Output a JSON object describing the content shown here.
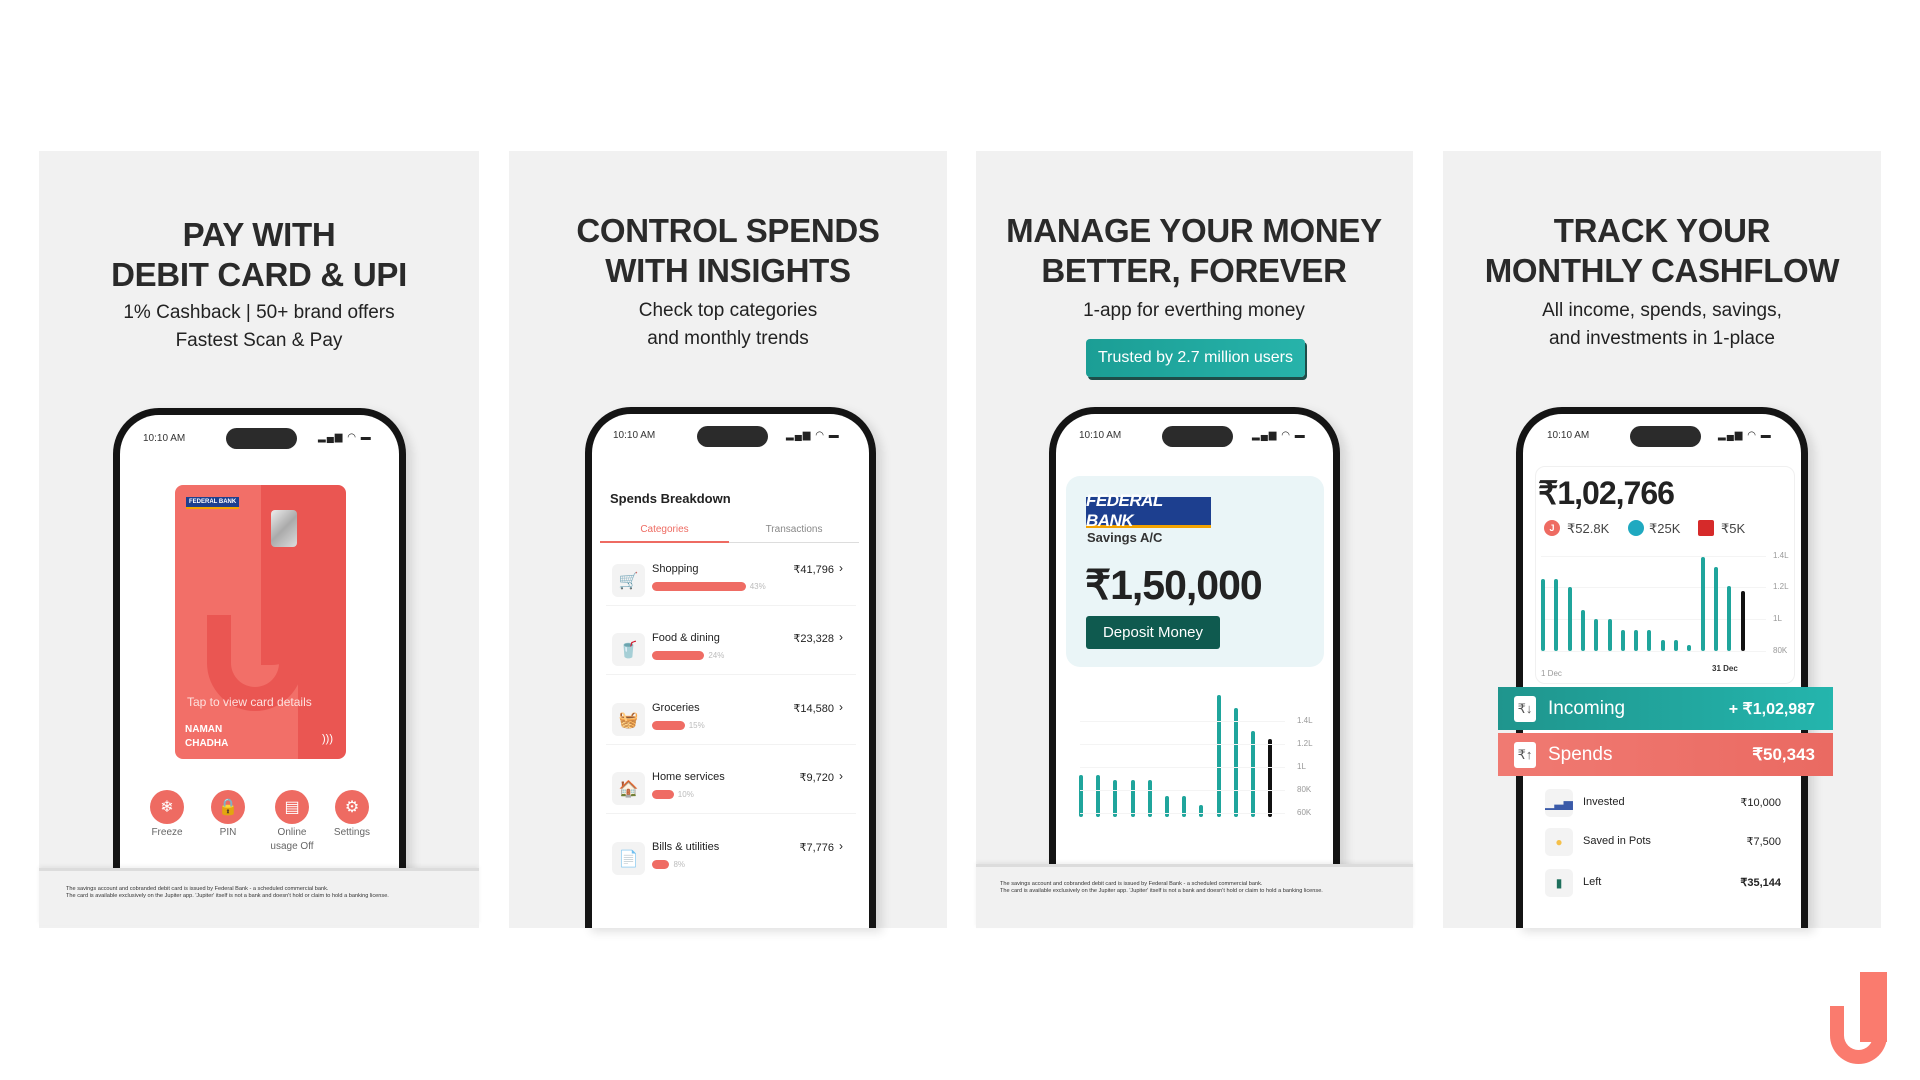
{
  "colors": {
    "accent_coral": "#ee6b62",
    "accent_teal": "#1fa59c",
    "dark_teal": "#0f5a4f",
    "logo": "#fa7b6e"
  },
  "status": {
    "time": "10:10 AM",
    "icons": "signal-wifi-battery"
  },
  "disclaimer": [
    "The savings account and cobranded debit card is issued by Federal Bank - a scheduled commercial bank.",
    "The card is available exclusively on the Jupiter app. 'Jupiter' itself is not a bank and doesn't hold or claim to hold a banking license."
  ],
  "panel1": {
    "title": [
      "PAY WITH",
      "DEBIT CARD & UPI"
    ],
    "subtitle": [
      "1% Cashback | 50+ brand offers",
      "Fastest Scan & Pay"
    ],
    "card": {
      "bank": "FEDERAL BANK",
      "tap": "Tap to view card details",
      "name": [
        "NAMAN",
        "CHADHA"
      ]
    },
    "actions": [
      {
        "label": "Freeze",
        "icon": "snowflake-icon"
      },
      {
        "label": "PIN",
        "icon": "lock-icon"
      },
      {
        "label": "Online",
        "label2": "usage Off",
        "icon": "laptop-icon"
      },
      {
        "label": "Settings",
        "icon": "gear-icon"
      }
    ]
  },
  "panel2": {
    "title": [
      "CONTROL SPENDS",
      "WITH INSIGHTS"
    ],
    "subtitle": [
      "Check top categories",
      "and monthly trends"
    ],
    "screen_title": "Spends Breakdown",
    "tabs": [
      "Categories",
      "Transactions"
    ],
    "rows": [
      {
        "label": "Shopping",
        "amount": "₹41,796",
        "pct": "43%",
        "value": 43,
        "icon": "🛒"
      },
      {
        "label": "Food & dining",
        "amount": "₹23,328",
        "pct": "24%",
        "value": 24,
        "icon": "🥤"
      },
      {
        "label": "Groceries",
        "amount": "₹14,580",
        "pct": "15%",
        "value": 15,
        "icon": "🧺"
      },
      {
        "label": "Home services",
        "amount": "₹9,720",
        "pct": "10%",
        "value": 10,
        "icon": "🏠"
      },
      {
        "label": "Bills & utilities",
        "amount": "₹7,776",
        "pct": "8%",
        "value": 8,
        "icon": "📄"
      }
    ]
  },
  "panel3": {
    "title": [
      "MANAGE YOUR MONEY",
      "BETTER, FOREVER"
    ],
    "subtitle": "1-app for everthing money",
    "badge": "Trusted by 2.7 million users",
    "bank": "FEDERAL BANK",
    "account": "Savings A/C",
    "balance": "₹1,50,000",
    "deposit": "Deposit Money",
    "chart": {
      "type": "bar",
      "ticks": [
        "1.4L",
        "1.2L",
        "1L",
        "80K",
        "60K"
      ],
      "tick_values": [
        140,
        120,
        100,
        80,
        60
      ],
      "unit": "K",
      "values": [
        93,
        93,
        89,
        89,
        89,
        75,
        75,
        67,
        163,
        152,
        132,
        125
      ],
      "highlight_last": true
    }
  },
  "panel4": {
    "title": [
      "TRACK YOUR",
      "MONTHLY CASHFLOW"
    ],
    "subtitle": [
      "All income, spends, savings,",
      "and investments in 1-place"
    ],
    "total": "₹1,02,766",
    "accounts": [
      {
        "icon": "jupiter-icon",
        "value": "₹52.8K",
        "color": "#ee6b62"
      },
      {
        "icon": "sbi-icon",
        "value": "₹25K",
        "color": "#1fa9c0"
      },
      {
        "icon": "hdfc-icon",
        "value": "₹5K",
        "color": "#d62a2a"
      }
    ],
    "chart": {
      "type": "bar",
      "ticks": [
        "1.4L",
        "1.2L",
        "1L",
        "80K"
      ],
      "tick_values": [
        140,
        120,
        100,
        80
      ],
      "unit": "K",
      "x_start": "1 Dec",
      "x_end": "31 Dec",
      "values": [
        125,
        125,
        120,
        106,
        100,
        100,
        93,
        93,
        93,
        87,
        87,
        84,
        139,
        133,
        121,
        118
      ],
      "highlight_last": true
    },
    "incoming": {
      "label": "Incoming",
      "amount": "+ ₹1,02,987"
    },
    "spends": {
      "label": "Spends",
      "amount": "₹50,343"
    },
    "rows": [
      {
        "label": "Invested",
        "amount": "₹10,000",
        "icon": "bar-chart-icon"
      },
      {
        "label": "Saved in Pots",
        "amount": "₹7,500",
        "icon": "pot-icon"
      },
      {
        "label": "Left",
        "amount": "₹35,144",
        "icon": "wallet-icon"
      }
    ]
  }
}
